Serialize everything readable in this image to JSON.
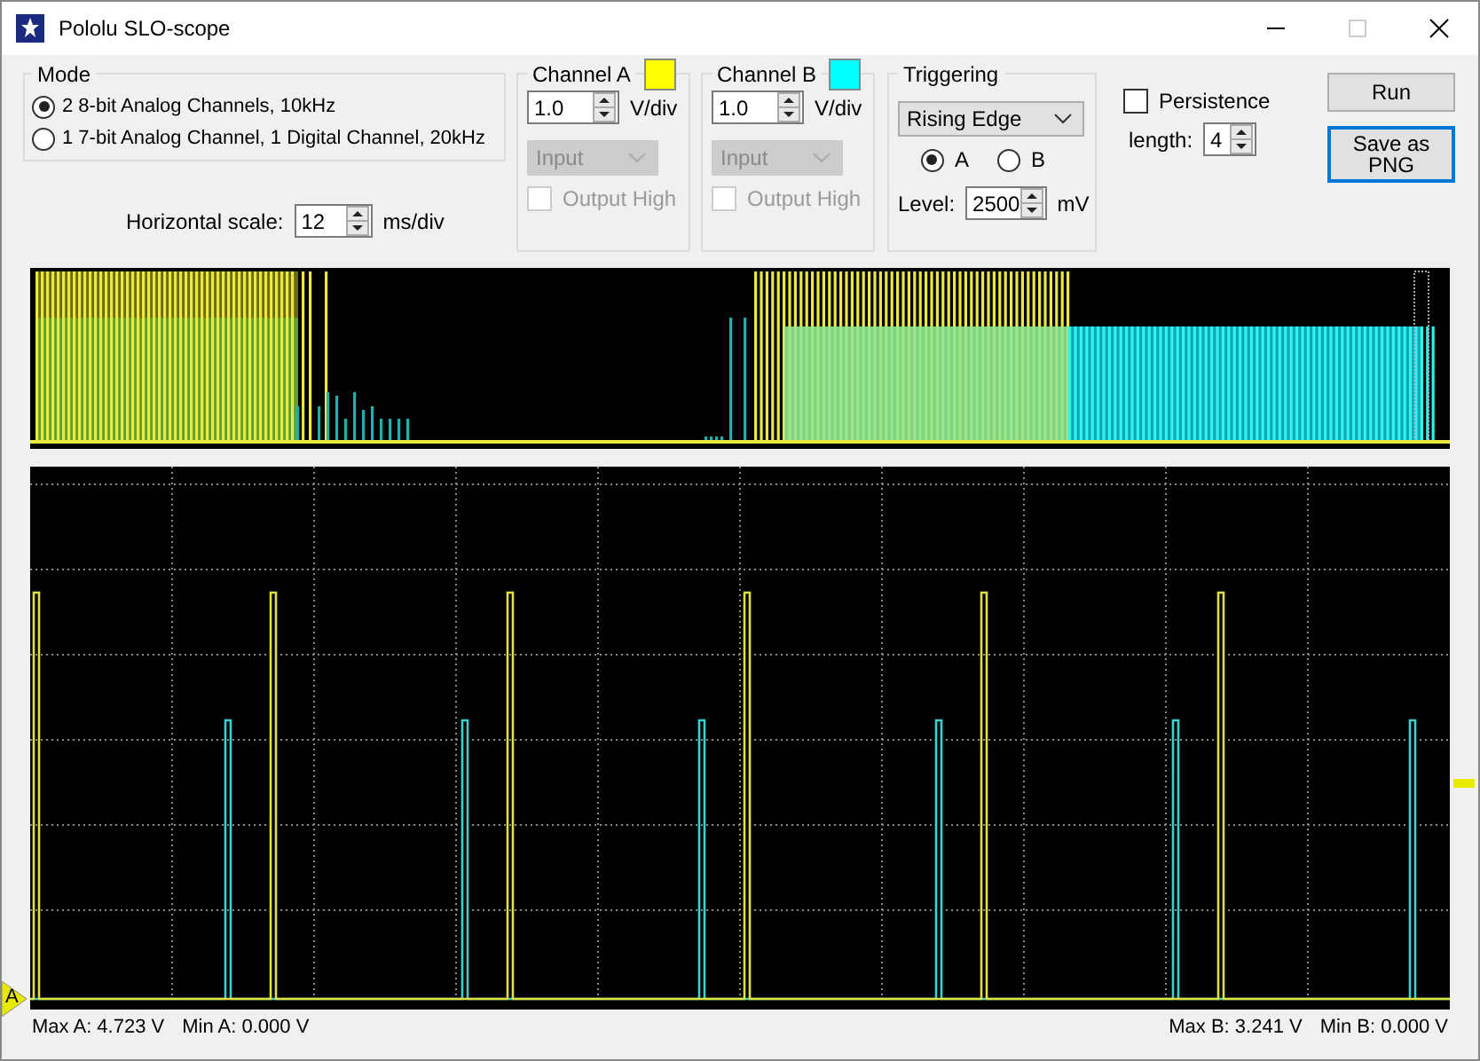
{
  "window": {
    "title": "Pololu SLO-scope"
  },
  "mode": {
    "title": "Mode",
    "options": [
      {
        "label": "2 8-bit Analog Channels, 10kHz",
        "selected": true
      },
      {
        "label": "1 7-bit Analog Channel, 1 Digital Channel, 20kHz",
        "selected": false
      }
    ]
  },
  "horizontal_scale": {
    "label": "Horizontal scale:",
    "value": "12",
    "unit": "ms/div"
  },
  "channels": [
    {
      "title": "Channel A",
      "color": "#ffff00",
      "scale": "1.0",
      "unit": "V/div",
      "input": {
        "value": "Input",
        "disabled": true
      },
      "output_high": {
        "label": "Output High",
        "checked": false,
        "disabled": true
      }
    },
    {
      "title": "Channel B",
      "color": "#00ffff",
      "scale": "1.0",
      "unit": "V/div",
      "input": {
        "value": "Input",
        "disabled": true
      },
      "output_high": {
        "label": "Output High",
        "checked": false,
        "disabled": true
      }
    }
  ],
  "triggering": {
    "title": "Triggering",
    "edge": "Rising Edge",
    "sources": [
      {
        "label": "A",
        "selected": true
      },
      {
        "label": "B",
        "selected": false
      }
    ],
    "level_label": "Level:",
    "level_value": "2500",
    "level_unit": "mV"
  },
  "persistence": {
    "label": "Persistence",
    "checked": false,
    "length_label": "length:",
    "length_value": "4"
  },
  "buttons": [
    {
      "label": "Run",
      "focused": false
    },
    {
      "label": "Save as PNG",
      "focused": true
    }
  ],
  "trigger_marker": "A",
  "status": {
    "left": [
      "Max A: 4.723 V",
      "Min A: 0.000 V"
    ],
    "right": [
      "Max B: 3.241 V",
      "Min B: 0.000 V"
    ]
  }
}
